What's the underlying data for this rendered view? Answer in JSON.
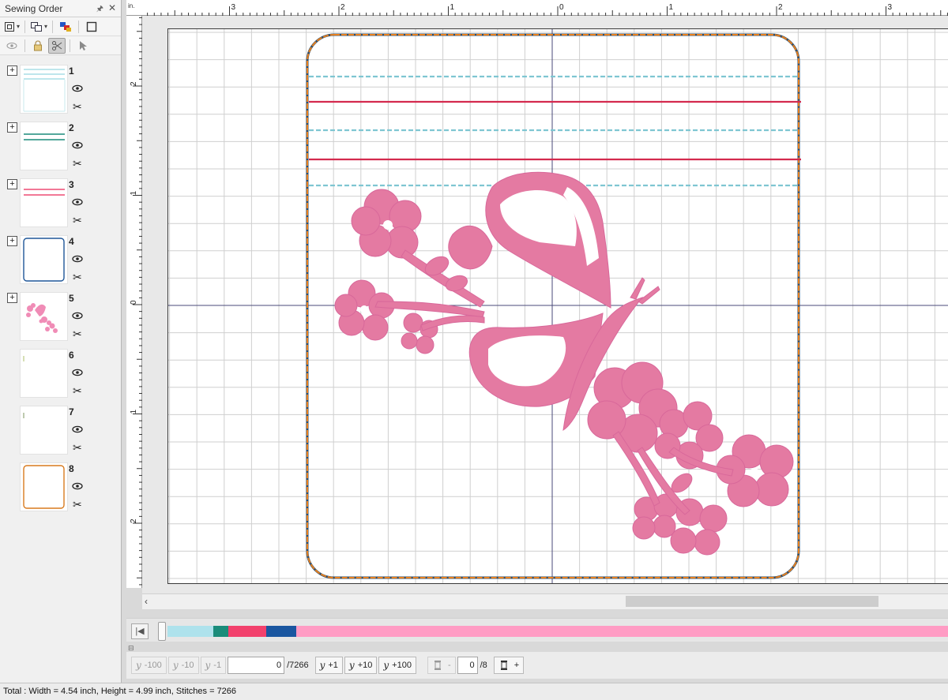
{
  "panel": {
    "title": "Sewing Order",
    "pin_icon": "pin-icon",
    "close_label": "✕"
  },
  "items": [
    {
      "number": "1",
      "color": "#a9dde6",
      "kind": "horizontal-lines"
    },
    {
      "number": "2",
      "color": "#1a8c7a",
      "kind": "horizontal-lines"
    },
    {
      "number": "3",
      "color": "#ee4c74",
      "kind": "horizontal-lines"
    },
    {
      "number": "4",
      "color": "#1e5698",
      "kind": "rounded-frame"
    },
    {
      "number": "5",
      "color": "#f08cb6",
      "kind": "motif"
    },
    {
      "number": "6",
      "color": "#c8d49a",
      "kind": "tick"
    },
    {
      "number": "7",
      "color": "#a8b894",
      "kind": "tick"
    },
    {
      "number": "8",
      "color": "#d87a1e",
      "kind": "rounded-frame"
    }
  ],
  "ruler": {
    "unit": "in.",
    "top_labels": [
      "3",
      "2",
      "1",
      "0",
      "1",
      "2",
      "3"
    ],
    "left_labels": [
      "2",
      "1",
      "0",
      "1",
      "2"
    ]
  },
  "colors": {
    "frame_orange": "#e8801e",
    "frame_dark": "#2a4e70",
    "line_teal": "#7fc6d2",
    "line_red": "#d42a4e",
    "motif_pink": "#e47aa2",
    "grid": "#cfcfcf",
    "axis": "#4a4a7a"
  },
  "colorbar": {
    "segments": [
      {
        "color": "#aee2ec",
        "width": 58
      },
      {
        "color": "#1a8c7a",
        "width": 19
      },
      {
        "color": "#f2406c",
        "width": 48
      },
      {
        "color": "#1a56a0",
        "width": 38
      },
      {
        "color": "#ff9cc4",
        "width": 825
      }
    ]
  },
  "stitch_nav": {
    "back100": "-100",
    "back10": "-10",
    "back1": "-1",
    "current_stitch": "0",
    "total_stitches": "/7266",
    "fwd1": "+1",
    "fwd10": "+10",
    "fwd100": "+100",
    "color_minus": "-",
    "current_color": "0",
    "total_colors": "/8",
    "color_plus": "+"
  },
  "status": {
    "text": "Total : Width = 4.54 inch, Height = 4.99 inch, Stitches = 7266"
  }
}
